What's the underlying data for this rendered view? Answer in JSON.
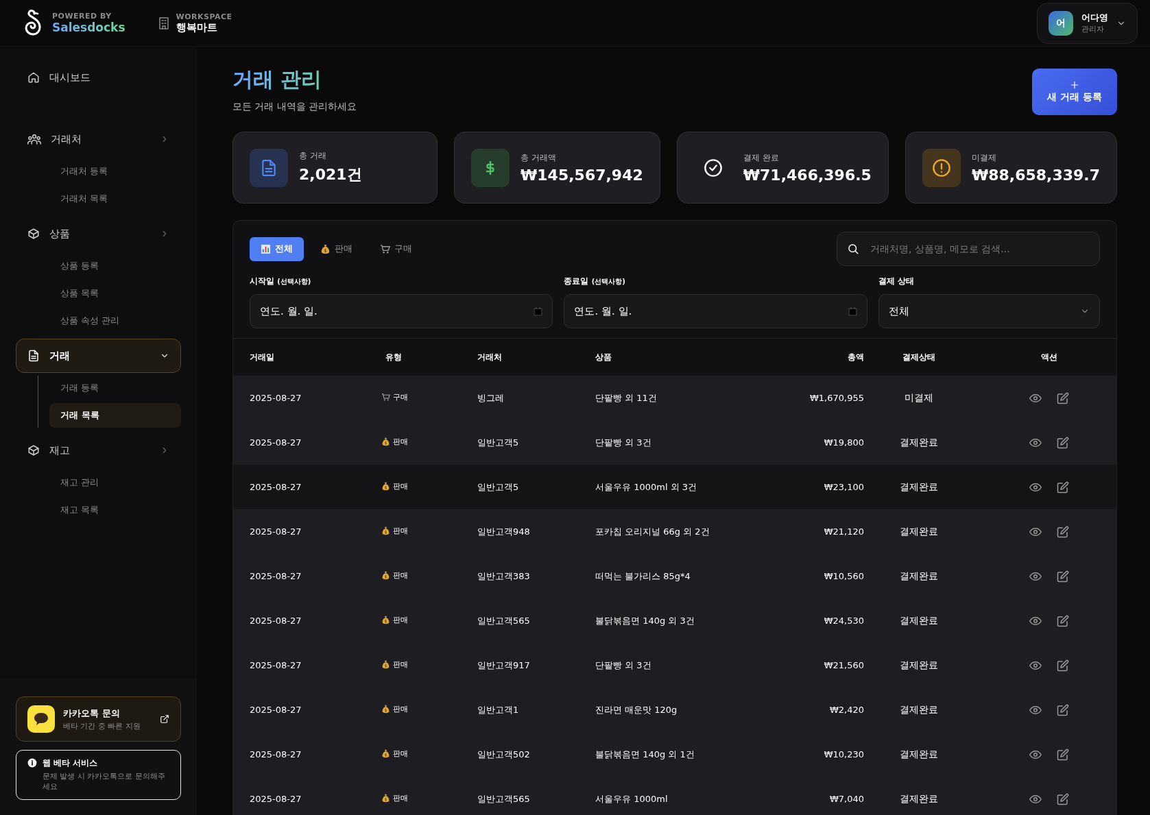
{
  "header": {
    "brand_caption": "POWERED BY",
    "brand_name": "Salesdocks",
    "workspace_caption": "WORKSPACE",
    "workspace_name": "행복마트",
    "user": {
      "initial": "어",
      "name": "어다영",
      "role": "관리자"
    }
  },
  "sidebar": {
    "items": [
      {
        "label": "대시보드",
        "kind": "home",
        "selected": false
      },
      {
        "label": "거래처",
        "kind": "users",
        "selected": false,
        "expanded": false,
        "children": [
          {
            "label": "거래처 등록",
            "selected": false
          },
          {
            "label": "거래처 목록",
            "selected": false
          }
        ]
      },
      {
        "label": "상품",
        "kind": "box",
        "selected": false,
        "expanded": false,
        "children": [
          {
            "label": "상품 등록",
            "selected": false
          },
          {
            "label": "상품 목록",
            "selected": false
          },
          {
            "label": "상품 속성 관리",
            "selected": false
          }
        ]
      },
      {
        "label": "거래",
        "kind": "doc",
        "selected": true,
        "expanded": true,
        "children": [
          {
            "label": "거래 등록",
            "selected": false
          },
          {
            "label": "거래 목록",
            "selected": true
          }
        ]
      },
      {
        "label": "재고",
        "kind": "box",
        "selected": false,
        "expanded": false,
        "children": [
          {
            "label": "재고 관리",
            "selected": false
          },
          {
            "label": "재고 목록",
            "selected": false
          }
        ]
      }
    ],
    "kakao": {
      "title": "카카오톡 문의",
      "subtitle": "베타 기간 중 빠른 지원"
    },
    "notice": {
      "title": "웹 베타 서비스",
      "text": "문제 발생 시 카카오톡으로 문의해주세요"
    }
  },
  "page": {
    "title": "거래 관리",
    "subtitle": "모든 거래 내역을 관리하세요",
    "new_button": "새 거래 등록"
  },
  "stats": [
    {
      "kind": "doc",
      "label": "총 거래",
      "value": "2,021건"
    },
    {
      "kind": "money",
      "label": "총 거래액",
      "value": "₩145,567,942"
    },
    {
      "kind": "check",
      "label": "결제 완료",
      "value": "₩71,466,396.5"
    },
    {
      "kind": "alert",
      "label": "미결제",
      "value": "₩88,658,339.7"
    }
  ],
  "tabs": [
    {
      "kind": "all",
      "label": "전체",
      "selected": true
    },
    {
      "kind": "sale",
      "label": "판매",
      "selected": false
    },
    {
      "kind": "purchase",
      "label": "구매",
      "selected": false
    }
  ],
  "search": {
    "placeholder": "거래처명, 상품명, 메모로 검색..."
  },
  "filters": {
    "start": {
      "label": "시작일",
      "hint": "(선택사항)",
      "value": "연도. 월. 일."
    },
    "end": {
      "label": "종료일",
      "hint": "(선택사항)",
      "value": "연도. 월. 일."
    },
    "status": {
      "label": "결제 상태",
      "value": "전체"
    }
  },
  "table": {
    "columns": [
      "거래일",
      "유형",
      "거래처",
      "상품",
      "총액",
      "결제상태",
      "액션"
    ],
    "rows": [
      {
        "date": "2025-08-27",
        "type": {
          "kind": "purchase",
          "label": "구매"
        },
        "partner": "빙그레",
        "product": "단팥빵 외 11건",
        "total": "₩1,670,955",
        "status": "미결제"
      },
      {
        "date": "2025-08-27",
        "type": {
          "kind": "sale",
          "label": "판매"
        },
        "partner": "일반고객5",
        "product": "단팥빵 외 3건",
        "total": "₩19,800",
        "status": "결제완료"
      },
      {
        "date": "2025-08-27",
        "type": {
          "kind": "sale",
          "label": "판매"
        },
        "partner": "일반고객5",
        "product": "서울우유 1000ml 외 3건",
        "total": "₩23,100",
        "status": "결제완료"
      },
      {
        "date": "2025-08-27",
        "type": {
          "kind": "sale",
          "label": "판매"
        },
        "partner": "일반고객948",
        "product": "포카칩 오리지널 66g 외 2건",
        "total": "₩21,120",
        "status": "결제완료"
      },
      {
        "date": "2025-08-27",
        "type": {
          "kind": "sale",
          "label": "판매"
        },
        "partner": "일반고객383",
        "product": "떠먹는 불가리스 85g*4",
        "total": "₩10,560",
        "status": "결제완료"
      },
      {
        "date": "2025-08-27",
        "type": {
          "kind": "sale",
          "label": "판매"
        },
        "partner": "일반고객565",
        "product": "불닭볶음면 140g 외 3건",
        "total": "₩24,530",
        "status": "결제완료"
      },
      {
        "date": "2025-08-27",
        "type": {
          "kind": "sale",
          "label": "판매"
        },
        "partner": "일반고객917",
        "product": "단팥빵 외 3건",
        "total": "₩21,560",
        "status": "결제완료"
      },
      {
        "date": "2025-08-27",
        "type": {
          "kind": "sale",
          "label": "판매"
        },
        "partner": "일반고객1",
        "product": "진라면 매운맛 120g",
        "total": "₩2,420",
        "status": "결제완료"
      },
      {
        "date": "2025-08-27",
        "type": {
          "kind": "sale",
          "label": "판매"
        },
        "partner": "일반고객502",
        "product": "불닭볶음면 140g 외 1건",
        "total": "₩10,230",
        "status": "결제완료"
      },
      {
        "date": "2025-08-27",
        "type": {
          "kind": "sale",
          "label": "판매"
        },
        "partner": "일반고객565",
        "product": "서울우유 1000ml",
        "total": "₩7,040",
        "status": "결제완료"
      }
    ]
  }
}
